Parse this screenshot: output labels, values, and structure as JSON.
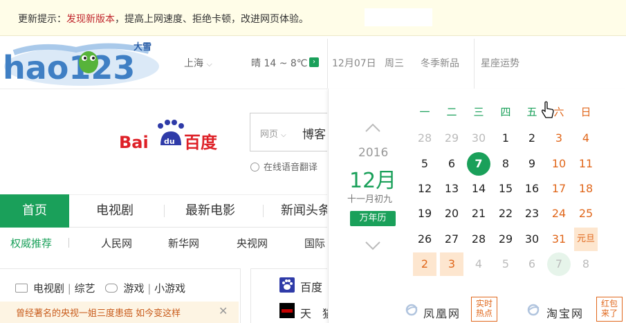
{
  "notice": {
    "prefix": "更新提示：",
    "link": "发现新版本",
    "suffix": "，提高上网速度、拒绝卡顿，改进网页体验。"
  },
  "header": {
    "logo_text": "hao123",
    "logo_tag": "大雪",
    "city": "上海",
    "weather": "晴  14 ~ 8℃",
    "date": "12月07日",
    "weekday": "周三",
    "season_link": "冬季新品",
    "astro_link": "星座运势"
  },
  "search": {
    "engine": "百度",
    "type_label": "网页",
    "value": "博客",
    "voice_label": "在线语音翻译"
  },
  "nav": {
    "items": [
      "首页",
      "电视剧",
      "最新电影",
      "新闻头条"
    ]
  },
  "subnav": {
    "highlight": "权威推荐",
    "items": [
      "人民网",
      "新华网",
      "央视网",
      "国际"
    ]
  },
  "categories": {
    "tv": "电视剧",
    "variety": "综艺",
    "games": "游戏",
    "mini_games": "小游戏",
    "sep": "|"
  },
  "ad": {
    "text": "曾经著名的央视一姐三度患癌 如今变这样",
    "close": "✕"
  },
  "sites": {
    "baidu": "百度",
    "tmall": "天　猫",
    "phoenix": "凤凰网",
    "taobao": "淘宝网",
    "phoenix_badge": [
      "实时",
      "热点"
    ],
    "taobao_badge": [
      "红包",
      "来了"
    ]
  },
  "calendar": {
    "year": "2016",
    "month": "12月",
    "lunar": "十一月初九",
    "button": "万年历",
    "weekdays": [
      "一",
      "二",
      "三",
      "四",
      "五",
      "六",
      "日"
    ],
    "rows": [
      [
        "28",
        "29",
        "30",
        "1",
        "2",
        "3",
        "4"
      ],
      [
        "5",
        "6",
        "7",
        "8",
        "9",
        "10",
        "11"
      ],
      [
        "12",
        "13",
        "14",
        "15",
        "16",
        "17",
        "18"
      ],
      [
        "19",
        "20",
        "21",
        "22",
        "23",
        "24",
        "25"
      ],
      [
        "26",
        "27",
        "28",
        "29",
        "30",
        "31",
        "元旦"
      ],
      [
        "2",
        "3",
        "4",
        "5",
        "6",
        "7",
        "8"
      ]
    ],
    "today": "7",
    "colors": {
      "accent": "#1aa05a",
      "weekend": "#e0661a",
      "holiday_bg": "#fde6cf"
    }
  }
}
